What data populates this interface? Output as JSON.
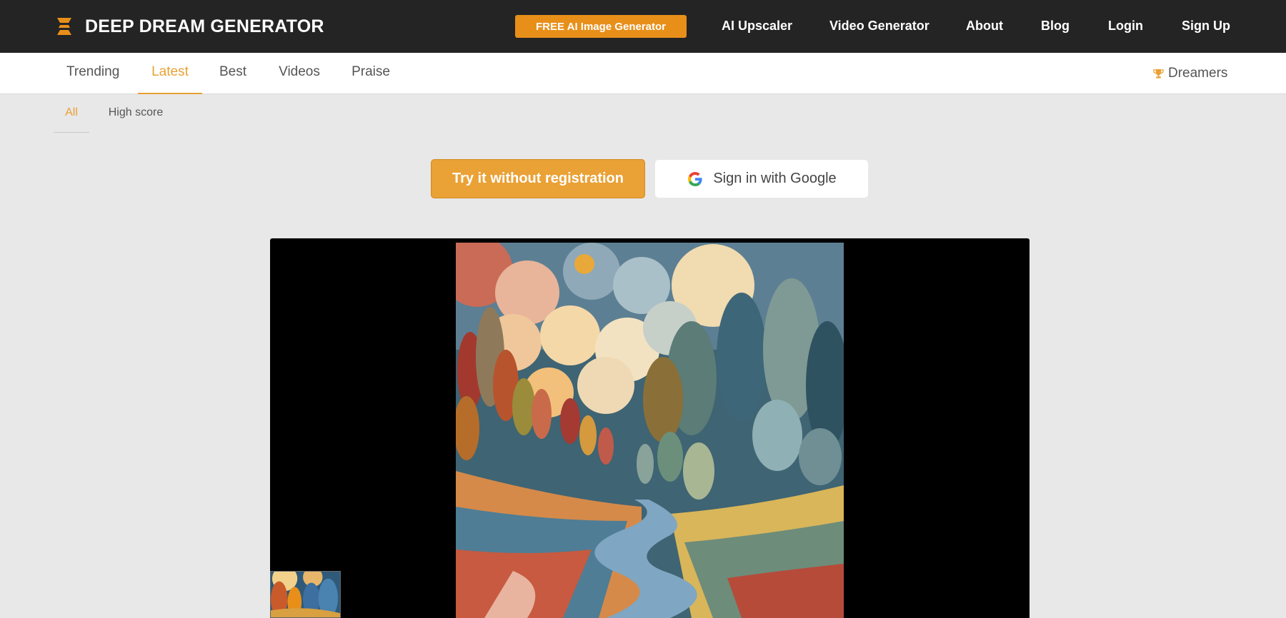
{
  "header": {
    "logo_text": "DEEP DREAM GENERATOR",
    "logo_icon": "hourglass-logo-icon",
    "cta_label": "FREE AI Image Generator",
    "nav": [
      {
        "label": "AI Upscaler"
      },
      {
        "label": "Video Generator"
      },
      {
        "label": "About"
      },
      {
        "label": "Blog"
      },
      {
        "label": "Login"
      },
      {
        "label": "Sign Up"
      }
    ],
    "background_color": "#242424",
    "accent_color": "#e88f1a"
  },
  "tabs": {
    "items": [
      {
        "label": "Trending"
      },
      {
        "label": "Latest"
      },
      {
        "label": "Best"
      },
      {
        "label": "Videos"
      },
      {
        "label": "Praise"
      }
    ],
    "active": "Latest",
    "dreamers_label": "Dreamers",
    "dreamers_icon": "trophy-icon"
  },
  "filters": {
    "items": [
      {
        "label": "All"
      },
      {
        "label": "High score"
      }
    ],
    "active": "All"
  },
  "auth": {
    "try_label": "Try it without registration",
    "google_label": "Sign in with Google",
    "google_icon": "google-g-icon"
  },
  "viewer": {
    "background_color": "#000000",
    "image_subject": "colorful painted landscape with winding river, trees and moon",
    "thumbnail_subject": "painted forest with autumn trees"
  }
}
